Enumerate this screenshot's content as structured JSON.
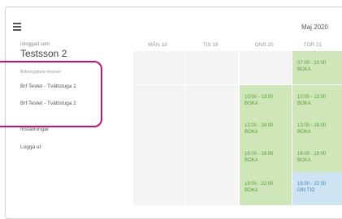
{
  "sidebar": {
    "logged_in_label": "Inloggad som",
    "username": "Testsson 2",
    "resources_heading": "Bokningsbara resurser",
    "resources": [
      "Brf Testet - Tvättstuga 1",
      "Brf Testet - Tvättstuga 2"
    ],
    "settings": "Inställningar",
    "logout": "Logga ut"
  },
  "calendar": {
    "month": "Maj 2020",
    "days": [
      "MÅN 18",
      "TIS 19",
      "ONS 20",
      "TOR 21"
    ],
    "rows": [
      [
        null,
        null,
        null,
        {
          "time": "07:00 - 10:00",
          "action": "BOKA",
          "status": "free"
        }
      ],
      [
        null,
        null,
        {
          "time": "10:00 - 13:00",
          "action": "BOKA",
          "status": "free"
        },
        {
          "time": "10:00 - 13:00",
          "action": "BOKA",
          "status": "free"
        }
      ],
      [
        null,
        null,
        {
          "time": "13:00 - 16:00",
          "action": "BOKA",
          "status": "free"
        },
        {
          "time": "13:00 - 16:00",
          "action": "BOKA",
          "status": "free"
        }
      ],
      [
        null,
        null,
        {
          "time": "16:00 - 19:00",
          "action": "BOKA",
          "status": "free"
        },
        {
          "time": "16:00 - 19:00",
          "action": "BOKA",
          "status": "free"
        }
      ],
      [
        null,
        null,
        {
          "time": "19:00 - 22:00",
          "action": "BOKA",
          "status": "free"
        },
        {
          "time": "19:00 - 22:00",
          "action": "DIN TID",
          "status": "mine"
        }
      ]
    ]
  },
  "colors": {
    "free_slot": "#cfe7b8",
    "own_booking": "#cfe4f3",
    "empty_slot": "#f4f4f4",
    "highlight": "#c0157c"
  },
  "icons": {
    "menu": "hamburger-menu-icon"
  }
}
